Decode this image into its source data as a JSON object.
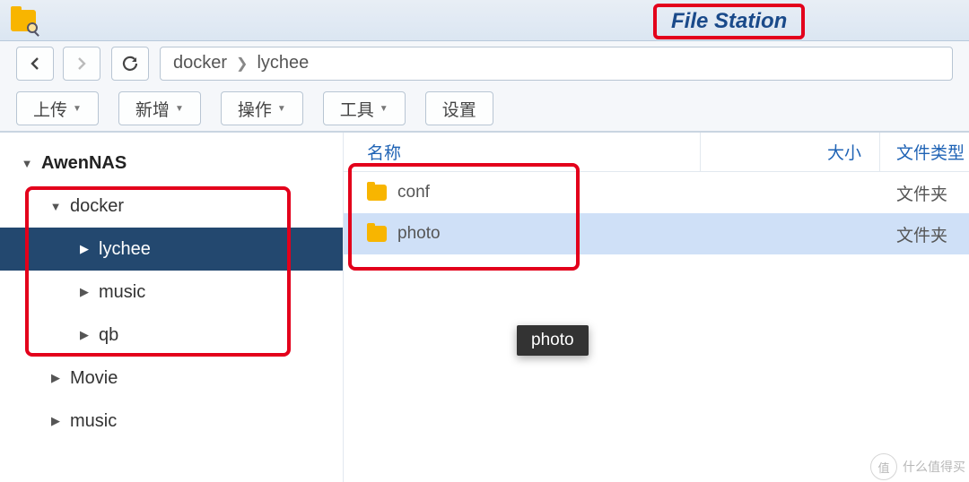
{
  "app": {
    "title": "File Station"
  },
  "breadcrumb": {
    "seg1": "docker",
    "seg2": "lychee"
  },
  "toolbar": {
    "upload": "上传",
    "new": "新增",
    "action": "操作",
    "tools": "工具",
    "settings": "设置"
  },
  "tree": {
    "root": "AwenNAS",
    "items": [
      {
        "label": "docker",
        "expanded": true
      },
      {
        "label": "lychee",
        "child": true,
        "selected": true
      },
      {
        "label": "music",
        "child": true
      },
      {
        "label": "qb",
        "child": true
      },
      {
        "label": "Movie"
      },
      {
        "label": "music"
      }
    ]
  },
  "columns": {
    "name": "名称",
    "size": "大小",
    "type": "文件类型"
  },
  "rows": [
    {
      "name": "conf",
      "type": "文件夹",
      "selected": false
    },
    {
      "name": "photo",
      "type": "文件夹",
      "selected": true
    }
  ],
  "tooltip": "photo",
  "watermark": {
    "badge": "值",
    "text": "什么值得买"
  }
}
